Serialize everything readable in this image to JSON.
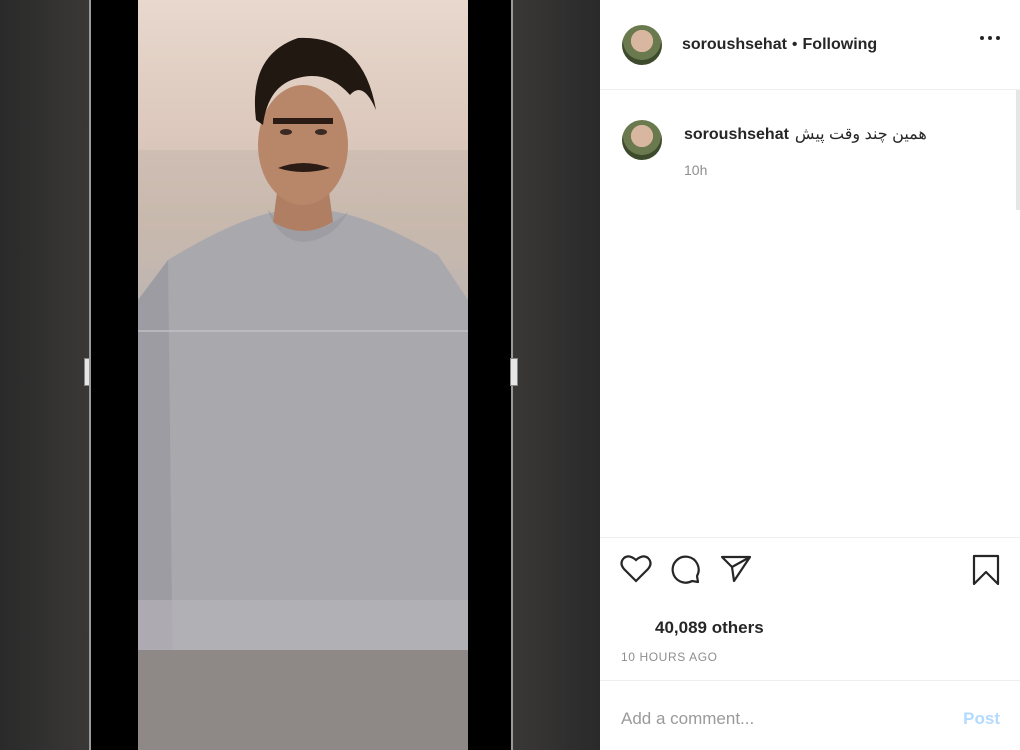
{
  "post": {
    "username": "soroushsehat",
    "separator": "•",
    "follow_status": "Following"
  },
  "caption": {
    "username": "soroushsehat",
    "text": "همین چند وقت پیش",
    "time": "10h"
  },
  "stats": {
    "likes": "40,089 others",
    "posted_ago": "10 HOURS AGO"
  },
  "comment_box": {
    "placeholder": "Add a comment...",
    "post_label": "Post"
  },
  "icons": [
    "more-options-icon",
    "heart-icon",
    "comment-icon",
    "share-icon",
    "bookmark-icon"
  ]
}
